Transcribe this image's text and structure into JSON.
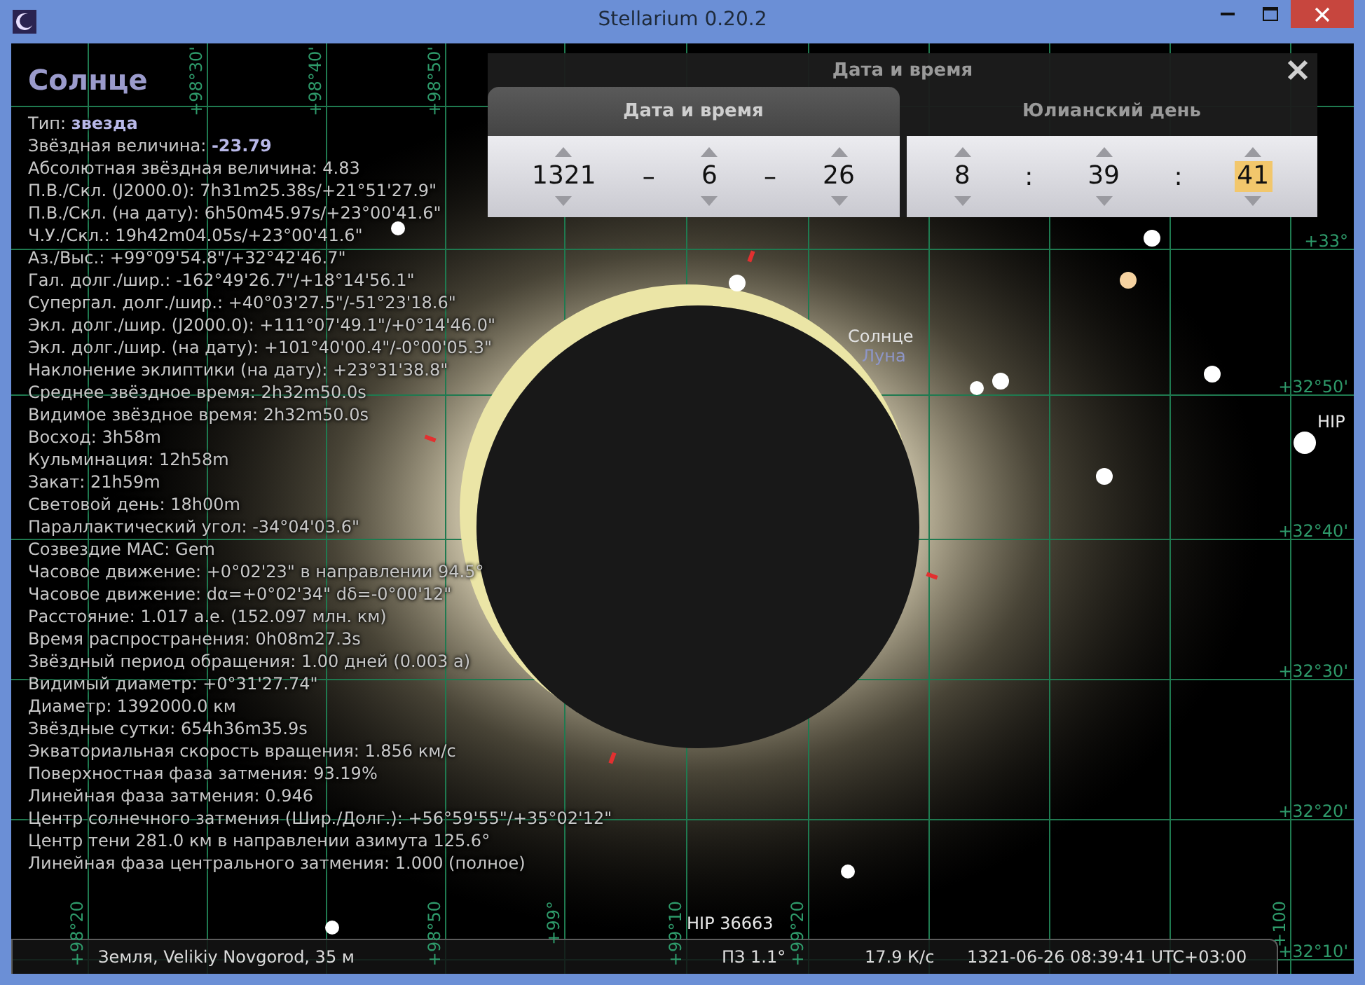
{
  "window": {
    "title": "Stellarium 0.20.2"
  },
  "info": {
    "title": "Солнце",
    "lines": [
      "Тип: **звезда**",
      "Звёздная величина: **-23.79**",
      "Абсолютная звёздная величина: 4.83",
      "П.В./Скл. (J2000.0): 7h31m25.38s/+21°51'27.9\"",
      "П.В./Скл. (на дату): 6h50m45.97s/+23°00'41.6\"",
      "Ч.У./Скл.: 19h42m04.05s/+23°00'41.6\"",
      "Аз./Выс.: +99°09'54.8\"/+32°42'46.7\"",
      "Гал. долг./шир.: -162°49'26.7\"/+18°14'56.1\"",
      "Супергал. долг./шир.: +40°03'27.5\"/-51°23'18.6\"",
      "Экл. долг./шир. (J2000.0): +111°07'49.1\"/+0°14'46.0\"",
      "Экл. долг./шир. (на дату): +101°40'00.4\"/-0°00'05.3\"",
      "Наклонение эклиптики (на дату): +23°31'38.8\"",
      "Среднее звёздное время: 2h32m50.0s",
      "Видимое звёздное время: 2h32m50.0s",
      "Восход: 3h58m",
      "Кульминация: 12h58m",
      "Закат: 21h59m",
      "Световой день: 18h00m",
      "Параллактический угол: -34°04'03.6\"",
      "Созвездие МАС: Gem",
      "Часовое движение: +0°02'23\" в направлении 94.5°",
      "Часовое движение: dα=+0°02'34\" dδ=-0°00'12\"",
      "Расстояние: 1.017 а.е. (152.097 млн. км)",
      "Время распространения: 0h08m27.3s",
      "Звёздный период обращения: 1.00 дней (0.003 a)",
      "Видимый диаметр: +0°31'27.74\"",
      "Диаметр: 1392000.0 км",
      "Звёздные сутки: 654h36m35.9s",
      "Экваториальная скорость вращения: 1.856 км/с",
      "Поверхностная фаза затмения: 93.19%",
      "Линейная фаза затмения: 0.946",
      "Центр солнечного затмения (Шир./Долг.): +56°59'55\"/+35°02'12\"",
      "Центр тени 281.0 км в направлении азимута 125.6°",
      "Линейная фаза центрального затмения: 1.000 (полное)"
    ]
  },
  "sky_labels": [
    {
      "text": "Солнце",
      "kind": "object"
    },
    {
      "text": "Луна",
      "kind": "secondary"
    },
    {
      "text": "HIP",
      "kind": "star"
    },
    {
      "text": "HIP 36663",
      "kind": "star"
    }
  ],
  "grid": {
    "right_labels": [
      "+33°",
      "+32°50'",
      "+32°40'",
      "+32°30'",
      "+32°20'",
      "+32°10'"
    ],
    "top_labels": [
      "+98°30'",
      "+98°40'",
      "+98°50'"
    ],
    "bottom_labels": [
      "+98°20",
      "+98°50",
      "+99°",
      "+99°10",
      "+99°20",
      "+100"
    ]
  },
  "dialog": {
    "title": "Дата и время",
    "tabs": [
      {
        "label": "Дата и время",
        "selected": true
      },
      {
        "label": "Юлианский день",
        "selected": false
      }
    ],
    "date": [
      {
        "value": "1321",
        "selected": false
      },
      {
        "value": "6",
        "selected": false
      },
      {
        "value": "26",
        "selected": false
      }
    ],
    "date_separators": [
      "–",
      "–"
    ],
    "time": [
      {
        "value": "8",
        "selected": false
      },
      {
        "value": "39",
        "selected": false
      },
      {
        "value": "41",
        "selected": true
      }
    ],
    "time_separators": [
      ":",
      ":"
    ]
  },
  "status_bar": {
    "location": "Земля, Velikiy Novgorod, 35 м",
    "fov": "ПЗ 1.1°",
    "fps": "17.9 К/с",
    "datetime": "1321-06-26 08:39:41 UTC+03:00"
  }
}
